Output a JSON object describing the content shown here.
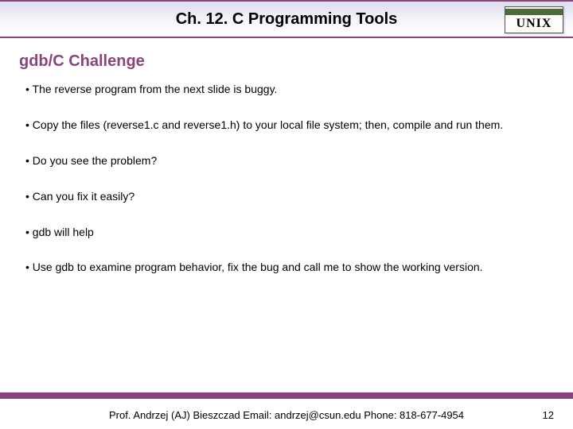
{
  "header": {
    "chapter_title": "Ch. 12. C Programming Tools",
    "badge_label": "UNIX"
  },
  "section_title": "gdb/C Challenge",
  "bullets": [
    "The reverse program from the next slide is buggy.",
    "Copy the files (reverse1.c and reverse1.h) to your local file system; then, compile and run them.",
    "Do you see the problem?",
    "Can you fix it easily?",
    "gdb will help",
    "Use gdb to examine program behavior, fix the bug and call me to show the working version."
  ],
  "footer": {
    "text": "Prof. Andrzej (AJ) Bieszczad Email: andrzej@csun.edu Phone: 818-677-4954",
    "page_number": "12"
  }
}
